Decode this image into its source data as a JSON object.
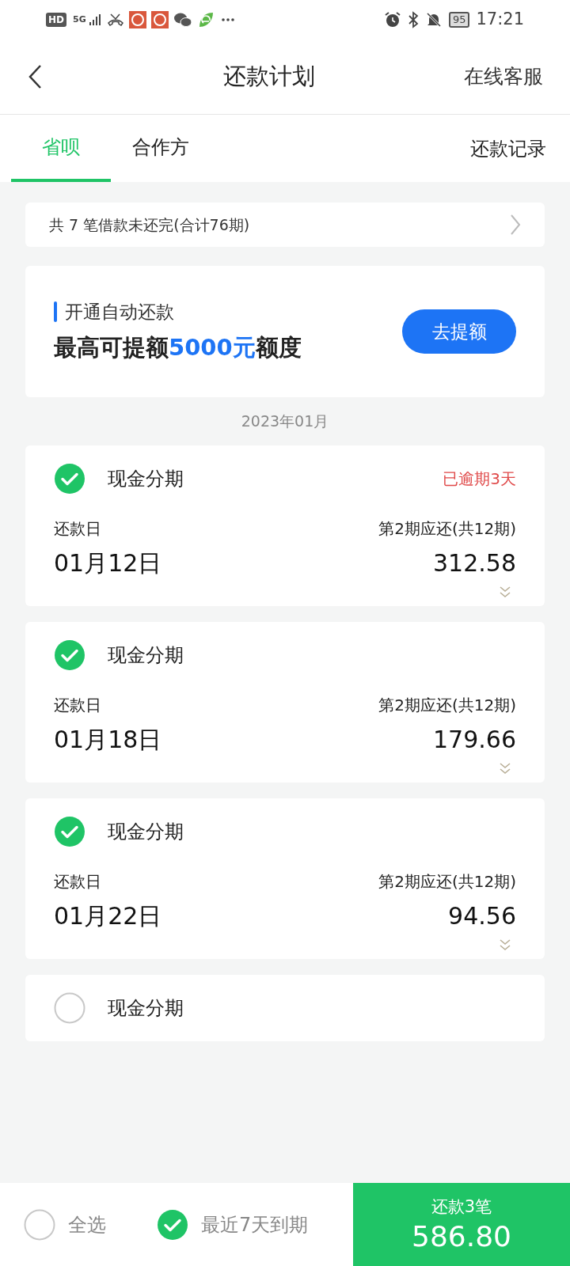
{
  "status_bar": {
    "badges": [
      "HD",
      "5G"
    ],
    "battery": "95",
    "time": "17:21"
  },
  "header": {
    "title": "还款计划",
    "action": "在线客服"
  },
  "tabs": [
    {
      "label": "省呗",
      "selected": true
    },
    {
      "label": "合作方",
      "selected": false
    }
  ],
  "tab_link": "还款记录",
  "summary": "共 7 笔借款未还完(合计76期)",
  "promo": {
    "title": "开通自动还款",
    "headline_before": "最高可提额",
    "headline_amount": "5000元",
    "headline_after": "额度",
    "button": "去提额"
  },
  "month": "2023年01月",
  "loans": [
    {
      "name": "现金分期",
      "checked": true,
      "overdue": "已逾期3天",
      "date_label": "还款日",
      "date": "01月12日",
      "due_label": "第2期应还(共12期)",
      "amount": "312.58"
    },
    {
      "name": "现金分期",
      "checked": true,
      "date_label": "还款日",
      "date": "01月18日",
      "due_label": "第2期应还(共12期)",
      "amount": "179.66"
    },
    {
      "name": "现金分期",
      "checked": true,
      "date_label": "还款日",
      "date": "01月22日",
      "due_label": "第2期应还(共12期)",
      "amount": "94.56"
    },
    {
      "name": "现金分期",
      "checked": false
    }
  ],
  "footer": {
    "select_all": {
      "label": "全选",
      "checked": false
    },
    "recent": {
      "label": "最近7天到期",
      "checked": true
    },
    "pay_label": "还款3笔",
    "pay_amount": "586.80"
  }
}
